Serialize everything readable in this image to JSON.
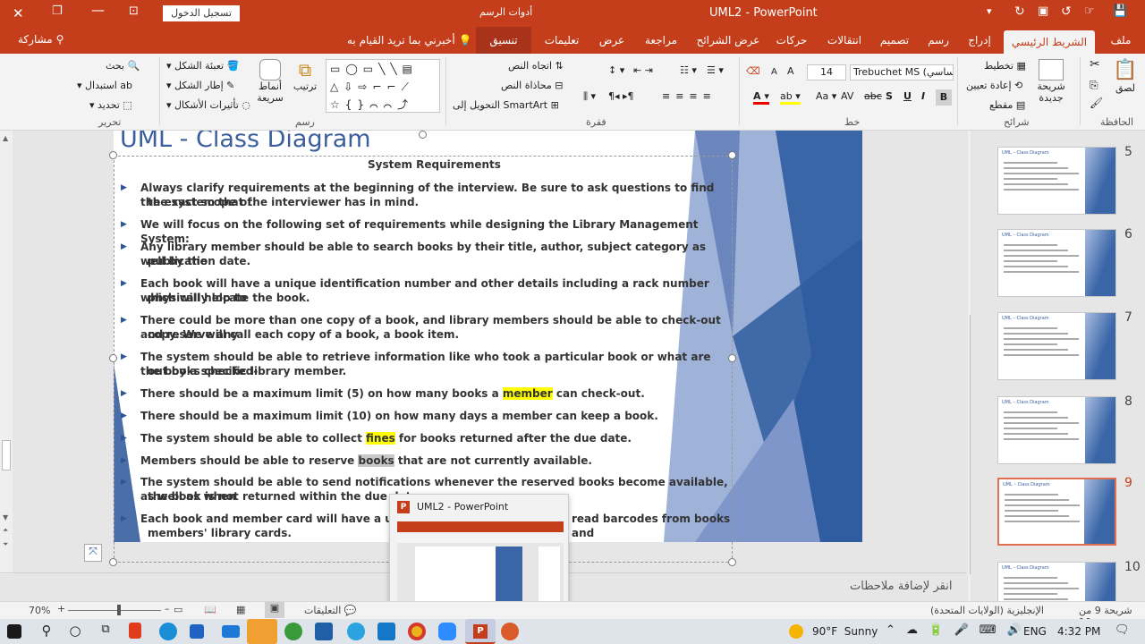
{
  "window": {
    "title": "UML2 - PowerPoint",
    "signin": "تسجيل الدخول",
    "drawing_tools": "أدوات الرسم"
  },
  "tabs": [
    "ملف",
    "الشريط الرئيسي",
    "إدراج",
    "رسم",
    "تصميم",
    "انتقالات",
    "حركات",
    "عرض الشرائح",
    "مراجعة",
    "عرض",
    "تعليمات",
    "تنسيق"
  ],
  "tellme": "أخبرني بما تريد القيام به",
  "share": "مشاركة",
  "ribbon": {
    "clipboard": {
      "paste": "لصق",
      "group": "الحافظة"
    },
    "slides": {
      "new_slide": "شريحة جديدة",
      "layout": "تخطيط",
      "reset": "إعادة تعيين",
      "section": "مقطع",
      "group": "شرائح"
    },
    "font": {
      "name": "Trebuchet MS (نص أساسي)",
      "size": "14",
      "group": "خط"
    },
    "paragraph": {
      "text_direction": "اتجاه النص",
      "align_text": "محاذاة النص",
      "smartart": "التحويل إلى SmartArt",
      "group": "فقرة"
    },
    "drawing": {
      "arrange": "ترتيب",
      "quick_styles": "أنماط سريعة",
      "fill": "تعبئة الشكل",
      "outline": "إطار الشكل",
      "effects": "تأثيرات الأشكال",
      "group": "رسم"
    },
    "editing": {
      "find": "بحث",
      "replace": "استبدال",
      "select": "تحديد",
      "group": "تحرير"
    }
  },
  "slide": {
    "title": "UML - Class Diagram",
    "subtitle": "System Requirements",
    "lines": [
      {
        "pre": "Always clarify requirements at the beginning of the interview. Be sure to ask questions to find the exact scope of",
        "hl": "",
        "post": "",
        "bullet": true
      },
      {
        "pre": "the system that    the interviewer has in mind.",
        "hl": "",
        "post": "",
        "bullet": false
      },
      {
        "pre": "We will focus on the following set of requirements while designing the Library Management System:",
        "hl": "",
        "post": "",
        "bullet": true
      },
      {
        "pre": "Any library member should be able to search books by their title, author, subject category as well by the",
        "hl": "",
        "post": "",
        "bullet": true
      },
      {
        "pre": "publication date.",
        "hl": "",
        "post": "",
        "bullet": false
      },
      {
        "pre": "Each book will have a unique identification number and other details including a rack number which will help to",
        "hl": "",
        "post": "",
        "bullet": true
      },
      {
        "pre": "physically locate the book.",
        "hl": "",
        "post": "",
        "bullet": false
      },
      {
        "pre": "There could be more than one copy of a book, and library members should be able to check-out and reserve any",
        "hl": "",
        "post": "",
        "bullet": true
      },
      {
        "pre": "copy. We will call each copy of a book, a book item.",
        "hl": "",
        "post": "",
        "bullet": false
      },
      {
        "pre": "The system should be able to retrieve information like who took a particular book or what are the books checked-",
        "hl": "",
        "post": "",
        "bullet": true
      },
      {
        "pre": "out by a specific library member.",
        "hl": "",
        "post": "",
        "bullet": false
      },
      {
        "pre": "There should be a maximum limit (5) on how many books a ",
        "hl": "member",
        "post": " can check-out.",
        "bullet": true
      },
      {
        "pre": "There should be a maximum limit (10) on how many days a member can keep a book.",
        "hl": "",
        "post": "",
        "bullet": true
      },
      {
        "pre": "The system should be able to collect ",
        "hl": "fines",
        "post": " for books returned after the due date.",
        "bullet": true
      },
      {
        "pre": "Members should be able to reserve ",
        "hlg": "books",
        "post": " that are not currently available.",
        "bullet": true
      },
      {
        "pre": "The system should be able to send notifications whenever the reserved books become available, as well as when",
        "hl": "",
        "post": "",
        "bullet": true
      },
      {
        "pre": "the book is not returned within the due date.",
        "hl": "",
        "post": "",
        "bullet": false
      },
      {
        "pre": "Each book and member card will have a unique b",
        "hl": "",
        "post": "",
        "bullet": true,
        "tail": "read barcodes from books and"
      },
      {
        "pre": "members' library cards.",
        "hl": "",
        "post": "",
        "bullet": false
      }
    ]
  },
  "thumbnails": [
    "5",
    "6",
    "7",
    "8",
    "9",
    "10"
  ],
  "thumb_title": "UML – Class Diagram",
  "notes": "انقر لإضافة ملاحظات",
  "status": {
    "slide_of": "شريحة 9 من 10",
    "language": "الإنجليزية (الولايات المتحدة)",
    "comments": "التعليقات",
    "zoom": "70%"
  },
  "preview": {
    "title": "UML2 - PowerPoint"
  },
  "taskbar": {
    "weather": "90°F  Sunny",
    "lang": "ENG",
    "time": "4:32 PM"
  }
}
